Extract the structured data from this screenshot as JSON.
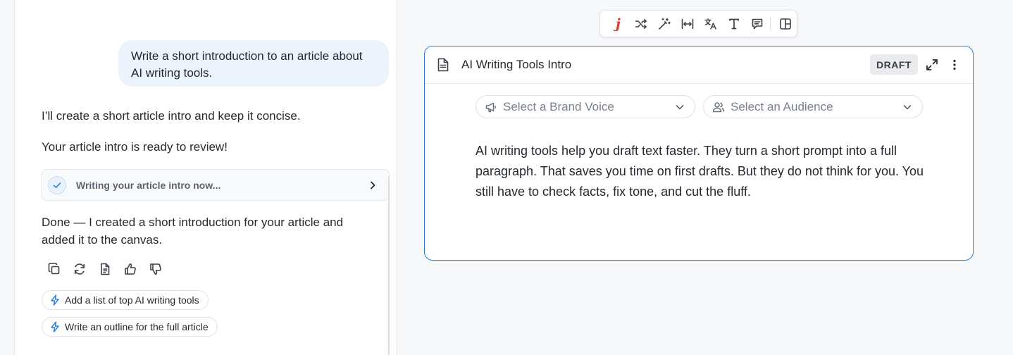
{
  "chat": {
    "user_message": "Write a short introduction to an article about AI writing tools.",
    "assistant_message_1": "I’ll create a short article intro and keep it concise.",
    "assistant_message_2": "Your article intro is ready to review!",
    "status_card": {
      "label": "Writing your article intro now..."
    },
    "assistant_message_3": "Done — I created a short introduction for your article and added it to the canvas.",
    "action_icons": [
      "copy-icon",
      "refresh-icon",
      "document-icon",
      "thumbs-up-icon",
      "thumbs-down-icon"
    ],
    "suggestions": [
      {
        "label": "Add a list of top AI writing tools",
        "icon": "lightning-icon"
      },
      {
        "label": "Write an outline for the full article",
        "icon": "lightning-icon"
      }
    ]
  },
  "toolbar": {
    "logo_glyph": "j",
    "tools": [
      "shuffle-icon",
      "magic-wand-icon",
      "adjust-length-icon",
      "translate-icon",
      "text-style-icon",
      "comment-icon",
      "layout-icon"
    ]
  },
  "canvas": {
    "title": "AI Writing Tools Intro",
    "badge": "DRAFT",
    "brand_voice_placeholder": "Select a Brand Voice",
    "audience_placeholder": "Select an Audience",
    "body": "AI writing tools help you draft text faster. They turn a short prompt into a full paragraph. That saves you time on first drafts. But they do not think for you. You still have to check facts, fix tone, and cut the fluff."
  },
  "colors": {
    "accent_blue": "#2f7fd6",
    "logo_red": "#e5372f",
    "user_bubble": "#ecf3fd"
  }
}
